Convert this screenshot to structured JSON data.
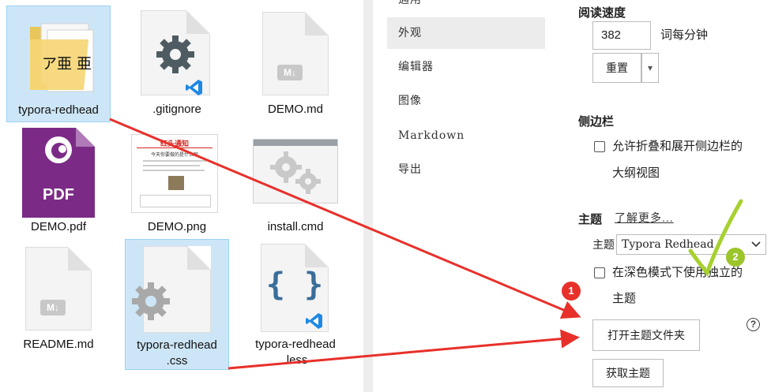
{
  "explorer": {
    "files": [
      {
        "name": "typora-redhead",
        "type": "folder",
        "folder_glyphs": "ア亜 亜"
      },
      {
        "name": ".gitignore",
        "type": "gear-vscode"
      },
      {
        "name": "DEMO.md",
        "type": "markdown",
        "badge": "M↓"
      },
      {
        "name": "DEMO.pdf",
        "type": "pdf",
        "badge": "PDF"
      },
      {
        "name": "DEMO.png",
        "type": "image",
        "doc_title": "红头通知",
        "doc_subtitle": "今天你要做的是什么呢"
      },
      {
        "name": "install.cmd",
        "type": "cmd"
      },
      {
        "name": "README.md",
        "type": "markdown",
        "badge": "M↓"
      },
      {
        "name": "typora-redhead\n.css",
        "type": "css"
      },
      {
        "name": "typora-redhead\n.less",
        "type": "less",
        "badge": "{ }"
      }
    ]
  },
  "prefs_nav": {
    "items": [
      {
        "label": "通用"
      },
      {
        "label": "外观"
      },
      {
        "label": "编辑器"
      },
      {
        "label": "图像"
      },
      {
        "label": "Markdown"
      },
      {
        "label": "导出"
      }
    ]
  },
  "prefs": {
    "reading_speed": {
      "title": "阅读速度",
      "value": "382",
      "unit": "词每分钟",
      "reset_label": "重置",
      "dropdown_glyph": "▾"
    },
    "sidebar": {
      "title": "侧边栏",
      "checkbox_label_line1": "允许折叠和展开侧边栏的",
      "checkbox_label_line2": "大纲视图"
    },
    "theme": {
      "title": "主题",
      "learn_more": "了解更多...",
      "select_label": "主题",
      "selected": "Typora Redhead",
      "dark_mode_line1": "在深色模式下使用独立的",
      "dark_mode_line2": "主题",
      "open_folder_label": "打开主题文件夹",
      "get_themes_label": "获取主题",
      "help_glyph": "?"
    }
  },
  "annotations": {
    "badge1": "1",
    "badge2": "2",
    "arrow_color": "#e8302a",
    "check_color": "#a6d12f"
  }
}
